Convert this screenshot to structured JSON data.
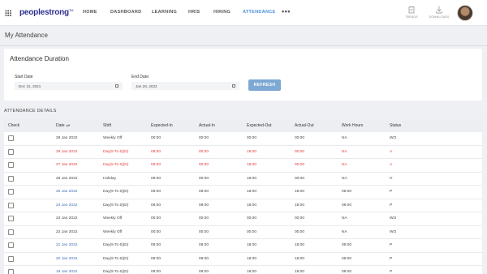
{
  "app": {
    "logo": "peoplestrong",
    "logo_mark": "TM",
    "nav": [
      "HOME",
      "DASHBOARD",
      "LEARNING",
      "HRIS",
      "HIRING",
      "ATTENDANCE"
    ],
    "nav_more": "•••",
    "active_nav": "ATTENDANCE",
    "tools": [
      {
        "label": "TRENDS",
        "icon": "trends-icon"
      },
      {
        "label": "DOWNLOADS",
        "icon": "download-icon"
      }
    ]
  },
  "page": {
    "title": "My Attendance"
  },
  "duration": {
    "title": "Attendance Duration",
    "start_label": "Start Date",
    "start_value": "Dec 31, 2021",
    "end_label": "End Date:",
    "end_value": "Jan 29, 2022",
    "refresh_label": "REFRESH"
  },
  "details": {
    "title": "ATTENDANCE DETAILS",
    "columns": [
      "Check",
      "Date",
      "Shift",
      "Expected-In",
      "Actual-In",
      "Expected-Out",
      "Actual-Out",
      "Work Hours",
      "Status"
    ],
    "rows": [
      {
        "date": "29 Jan 2022",
        "shift": "Weekly Off",
        "exp_in": "00:00",
        "act_in": "00:00",
        "exp_out": "00:00",
        "act_out": "00:00",
        "hours": "NA",
        "status": "WO",
        "style": "normal"
      },
      {
        "date": "28 Jan 2022",
        "shift": "Day(9 To 6)(D)",
        "exp_in": "09:00",
        "act_in": "00:00",
        "exp_out": "18:00",
        "act_out": "00:00",
        "hours": "NA",
        "status": "A",
        "style": "red"
      },
      {
        "date": "27 Jan 2022",
        "shift": "Day(9 To 6)(D)",
        "exp_in": "09:00",
        "act_in": "00:00",
        "exp_out": "18:00",
        "act_out": "00:00",
        "hours": "NA",
        "status": "A",
        "style": "red"
      },
      {
        "date": "26 Jan 2022",
        "shift": "Holiday",
        "exp_in": "09:00",
        "act_in": "00:00",
        "exp_out": "18:00",
        "act_out": "00:00",
        "hours": "NA",
        "status": "H",
        "style": "normal"
      },
      {
        "date": "25 Jan 2022",
        "shift": "Day(9 To 6)(D)",
        "exp_in": "09:00",
        "act_in": "09:00",
        "exp_out": "18:00",
        "act_out": "18:00",
        "hours": "09:00",
        "status": "P",
        "style": "blue"
      },
      {
        "date": "24 Jan 2022",
        "shift": "Day(9 To 6)(D)",
        "exp_in": "09:00",
        "act_in": "09:00",
        "exp_out": "18:00",
        "act_out": "18:00",
        "hours": "09:00",
        "status": "P",
        "style": "blue"
      },
      {
        "date": "23 Jan 2022",
        "shift": "Weekly Off",
        "exp_in": "00:00",
        "act_in": "00:00",
        "exp_out": "00:00",
        "act_out": "00:00",
        "hours": "NA",
        "status": "WO",
        "style": "normal"
      },
      {
        "date": "22 Jan 2022",
        "shift": "Weekly Off",
        "exp_in": "00:00",
        "act_in": "00:00",
        "exp_out": "00:00",
        "act_out": "00:00",
        "hours": "NA",
        "status": "WO",
        "style": "normal"
      },
      {
        "date": "21 Jan 2022",
        "shift": "Day(9 To 6)(D)",
        "exp_in": "09:00",
        "act_in": "09:00",
        "exp_out": "18:00",
        "act_out": "18:00",
        "hours": "09:00",
        "status": "P",
        "style": "blue"
      },
      {
        "date": "20 Jan 2022",
        "shift": "Day(9 To 6)(D)",
        "exp_in": "09:00",
        "act_in": "09:00",
        "exp_out": "18:00",
        "act_out": "18:00",
        "hours": "09:00",
        "status": "P",
        "style": "blue"
      },
      {
        "date": "19 Jan 2022",
        "shift": "Day(9 To 6)(D)",
        "exp_in": "09:00",
        "act_in": "09:00",
        "exp_out": "18:00",
        "act_out": "18:00",
        "hours": "09:00",
        "status": "P",
        "style": "blue"
      }
    ]
  },
  "colors": {
    "accent": "#4a8fd8",
    "brand": "#2c2f8f",
    "absent": "#e23b3b",
    "refresh_button": "#7ea8d4"
  }
}
